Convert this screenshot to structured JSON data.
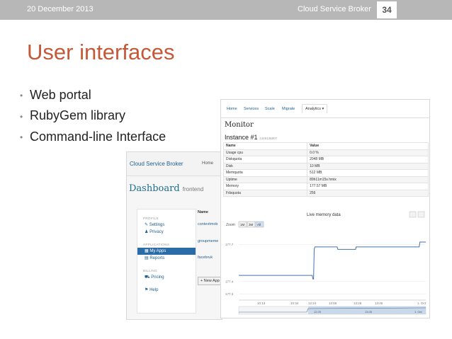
{
  "slide": {
    "date": "20 December 2013",
    "header_title": "Cloud Service Broker",
    "page_number": "34",
    "title": "User interfaces",
    "bullets": [
      "Web portal",
      "RubyGem library",
      "Command-line Interface"
    ],
    "colors": {
      "title": "#c4593a",
      "header_bar": "#b7b7b7",
      "link": "#1d5e8f",
      "active": "#2a6ca8"
    }
  },
  "portal": {
    "brand": "Cloud Service Broker",
    "nav_home": "Home",
    "heading": "Dashboard",
    "heading_sub": "frontend",
    "sidebar": {
      "profile_title": "PROFILE",
      "settings": "Settings",
      "privacy": "Privacy",
      "applications_title": "APPLICATIONS",
      "my_apps": "My Apps",
      "reports": "Reports",
      "billing_title": "BILLING",
      "pricing": "Pricing",
      "help": "Help"
    },
    "list_header": "Name",
    "rows": [
      "contextmob",
      "groupmeme",
      "facebruk"
    ],
    "new_app_button": "+ New App"
  },
  "monitor": {
    "tabs": [
      "Home",
      "Services",
      "Scale",
      "Migrate",
      "Analytics"
    ],
    "active_tab": "Analytics",
    "heading": "Monitor",
    "instance": "Instance #1",
    "instance_meta": "1349136807",
    "table_headers": [
      "Name",
      "Value"
    ],
    "table_rows": [
      [
        "Usage cpu",
        "0.0 %"
      ],
      [
        "Diskquota",
        "2048 MB"
      ],
      [
        "Disk",
        "10 MB"
      ],
      [
        "Memquota",
        "512 MB"
      ],
      [
        "Uptime",
        "89h11m15s hmix"
      ],
      [
        "Memory",
        "177.57 MB"
      ],
      [
        "Fdsquota",
        "256"
      ]
    ]
  },
  "chart_data": {
    "type": "line",
    "title": "Live memory data",
    "zoom_label": "Zoom",
    "zoom_options": [
      "1M",
      "3M",
      "All"
    ],
    "zoom_selected": "All",
    "y_ticks": [
      "177.7",
      "177.4",
      "177.3"
    ],
    "x_ticks": [
      "10:13",
      "10:34",
      "12:24",
      "12:56",
      "13:26",
      "13:46",
      "1. Oct"
    ],
    "navigator_ticks": [
      "12:25",
      "13:26",
      "1. Oct"
    ],
    "ylim": [
      177.25,
      177.8
    ],
    "series": [
      {
        "values": [
          177.42,
          177.41,
          177.41,
          177.41,
          177.41,
          177.41,
          177.41,
          177.41,
          177.41,
          177.41,
          177.41,
          177.41,
          177.41,
          177.41,
          177.41,
          177.41,
          177.41,
          177.41,
          177.41,
          177.41,
          177.41,
          177.41,
          177.41,
          177.41,
          177.41,
          177.41,
          177.41,
          177.41,
          177.41,
          177.41,
          177.41,
          177.41,
          177.41,
          177.41,
          177.41,
          177.41,
          177.41,
          177.41,
          177.41,
          177.41,
          177.41,
          177.41,
          177.41,
          177.41,
          177.41,
          177.41,
          177.41,
          177.41,
          177.41,
          177.41,
          177.41,
          177.41,
          177.41,
          177.41,
          177.41,
          177.41,
          177.41,
          177.41,
          177.41,
          177.41,
          177.41,
          177.41,
          177.41,
          177.41,
          177.41,
          177.41,
          177.41,
          177.41,
          177.41,
          177.41,
          177.41,
          177.41,
          177.41,
          177.41,
          177.41,
          177.41,
          177.41,
          177.41,
          177.41,
          177.41
        ],
        "note_points": null
      }
    ],
    "line_path": [
      [
        0,
        177.45
      ],
      [
        112,
        177.45
      ],
      [
        113,
        177.42
      ],
      [
        114,
        177.42
      ],
      [
        115,
        177.66
      ],
      [
        116,
        177.68
      ],
      [
        150,
        177.68
      ],
      [
        151,
        177.66
      ],
      [
        178,
        177.66
      ],
      [
        179,
        177.68
      ],
      [
        275,
        177.68
      ],
      [
        276,
        177.72
      ],
      [
        285,
        177.72
      ]
    ],
    "grid": true
  }
}
